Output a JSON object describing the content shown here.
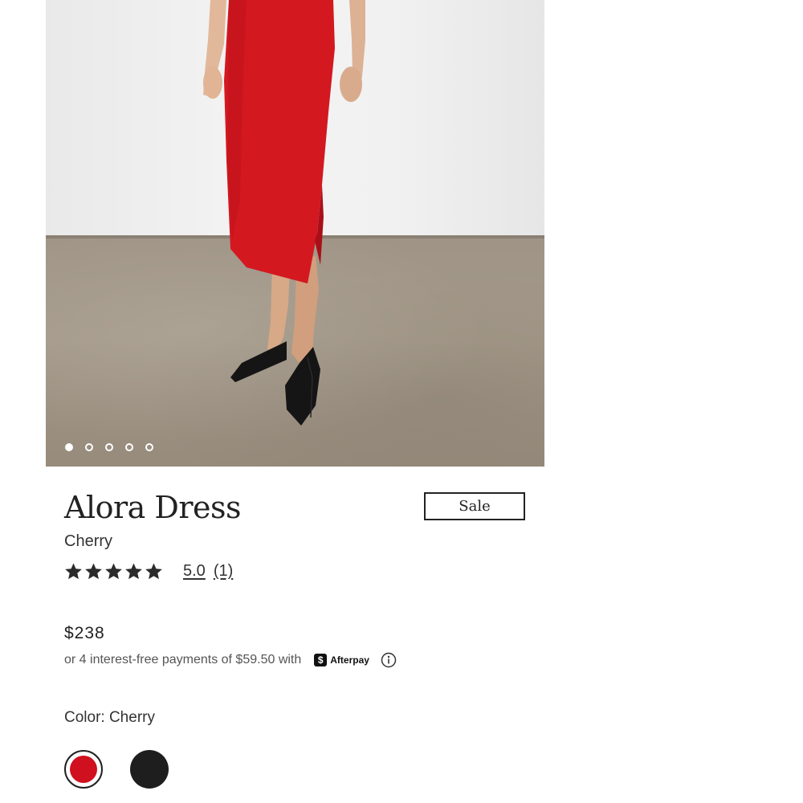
{
  "gallery": {
    "image_count": 5,
    "active_index": 0
  },
  "product": {
    "title": "Alora Dress",
    "badge": "Sale",
    "variant": "Cherry",
    "rating": {
      "stars": 5,
      "score": "5.0",
      "count": "(1)"
    },
    "price": "$238",
    "installments": {
      "text": "or 4 interest-free payments of $59.50 with",
      "provider_icon": "afterpay-icon",
      "provider_icon_glyph": "$",
      "provider": "Afterpay",
      "info_icon": "info-icon"
    },
    "color_label": "Color: Cherry",
    "swatches": [
      {
        "name": "Cherry",
        "color": "#d0101e",
        "selected": true
      },
      {
        "name": "Black",
        "color": "#1e1e1e",
        "selected": false
      }
    ]
  },
  "colors": {
    "dress": "#d41820",
    "text": "#222222",
    "star": "#2b2b2b"
  }
}
